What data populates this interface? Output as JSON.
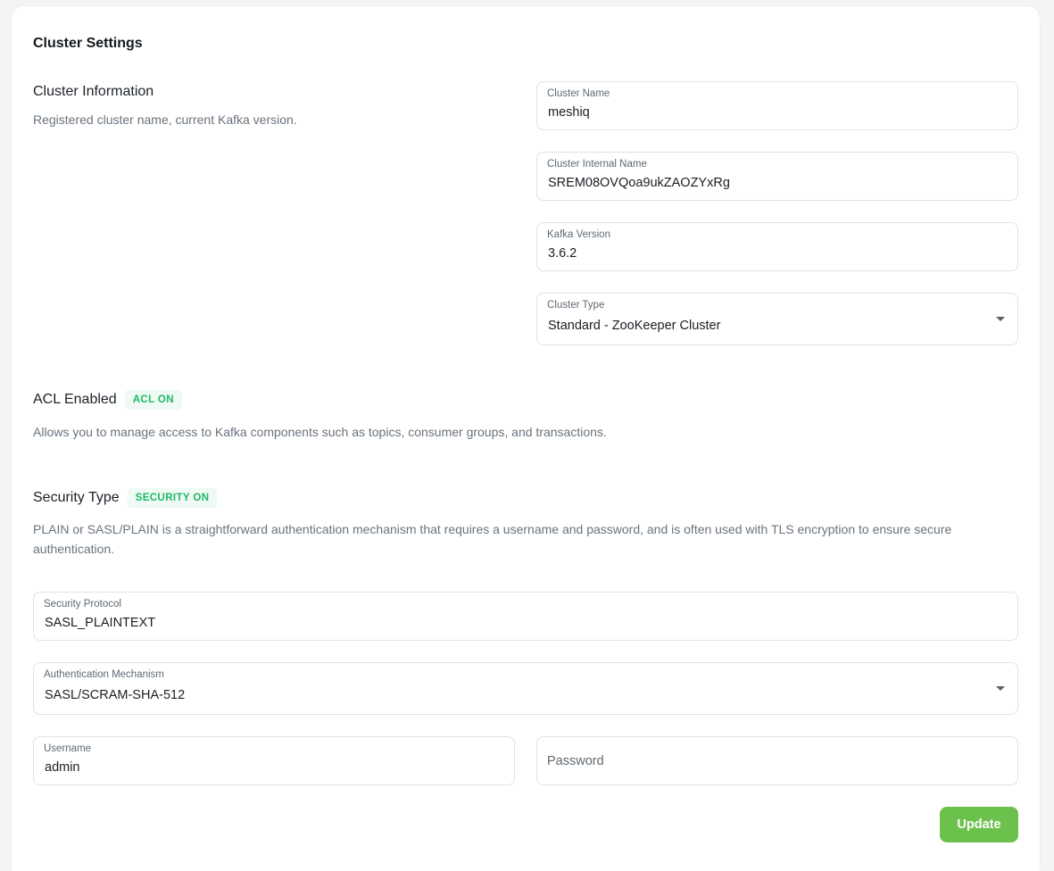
{
  "card": {
    "title": "Cluster Settings"
  },
  "cluster_info": {
    "heading": "Cluster Information",
    "description": "Registered cluster name, current Kafka version.",
    "cluster_name": {
      "label": "Cluster Name",
      "value": "meshiq"
    },
    "cluster_internal_name": {
      "label": "Cluster Internal Name",
      "value": "SREM08OVQoa9ukZAOZYxRg"
    },
    "kafka_version": {
      "label": "Kafka Version",
      "value": "3.6.2"
    },
    "cluster_type": {
      "label": "Cluster Type",
      "value": "Standard - ZooKeeper Cluster"
    }
  },
  "acl": {
    "heading": "ACL Enabled",
    "badge": "ACL ON",
    "description": "Allows you to manage access to Kafka components such as topics, consumer groups, and transactions."
  },
  "security": {
    "heading": "Security Type",
    "badge": "SECURITY ON",
    "description": "PLAIN or SASL/PLAIN is a straightforward authentication mechanism that requires a username and password, and is often used with TLS encryption to ensure secure authentication.",
    "protocol": {
      "label": "Security Protocol",
      "value": "SASL_PLAINTEXT"
    },
    "mechanism": {
      "label": "Authentication Mechanism",
      "value": "SASL/SCRAM-SHA-512"
    },
    "username": {
      "label": "Username",
      "value": "admin"
    },
    "password": {
      "placeholder": "Password",
      "value": ""
    }
  },
  "actions": {
    "update_label": "Update"
  },
  "colors": {
    "accent_button": "#6cc14c",
    "badge_text": "#1fb866",
    "badge_bg": "#eefaf3"
  }
}
